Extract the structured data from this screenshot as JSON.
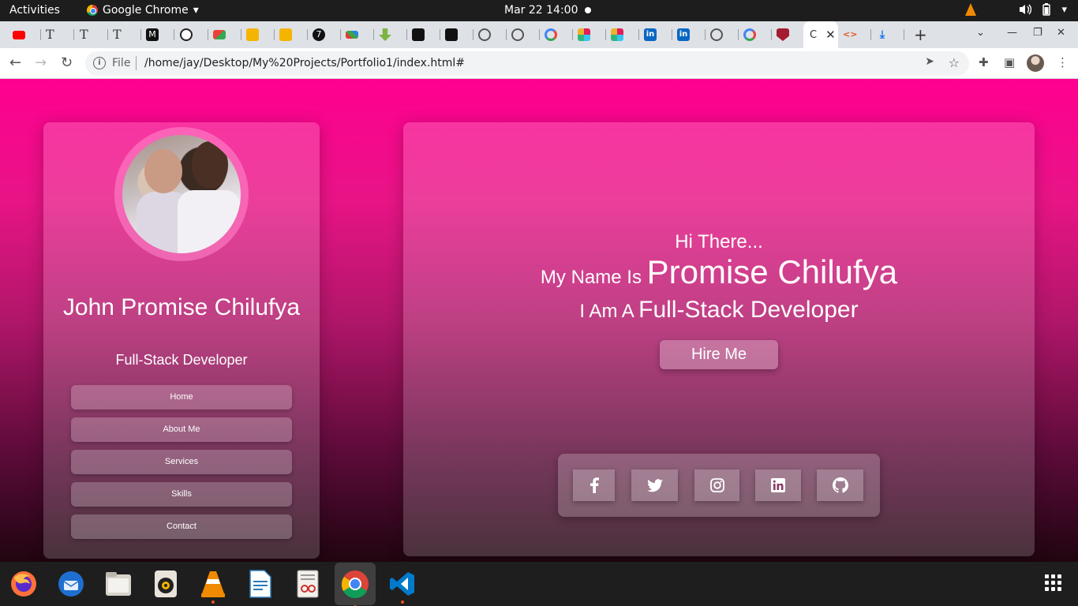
{
  "topbar": {
    "activities": "Activities",
    "app_name": "Google Chrome",
    "app_menu_arrow": "▾",
    "clock": "Mar 22  14:00"
  },
  "browser": {
    "address_scheme": "File",
    "url": "/home/jay/Desktop/My%20Projects/Portfolio1/index.html#",
    "new_tab": "+"
  },
  "profile": {
    "name": "John Promise Chilufya",
    "role": "Full-Stack Developer"
  },
  "nav": {
    "items": [
      {
        "label": "Home"
      },
      {
        "label": "About Me"
      },
      {
        "label": "Services"
      },
      {
        "label": "Skills"
      },
      {
        "label": "Contact"
      }
    ]
  },
  "hero": {
    "greeting": "Hi There...",
    "name_prefix": "My Name Is",
    "name": "Promise Chilufya",
    "role_prefix": "I Am A",
    "role": "Full-Stack Developer",
    "cta": "Hire Me"
  },
  "social": [
    "facebook-icon",
    "twitter-icon",
    "instagram-icon",
    "linkedin-icon",
    "github-icon"
  ],
  "colors": {
    "page_top": "#ff0090",
    "page_bottom": "#200510",
    "glass": "rgba(255,255,255,0.18)"
  }
}
